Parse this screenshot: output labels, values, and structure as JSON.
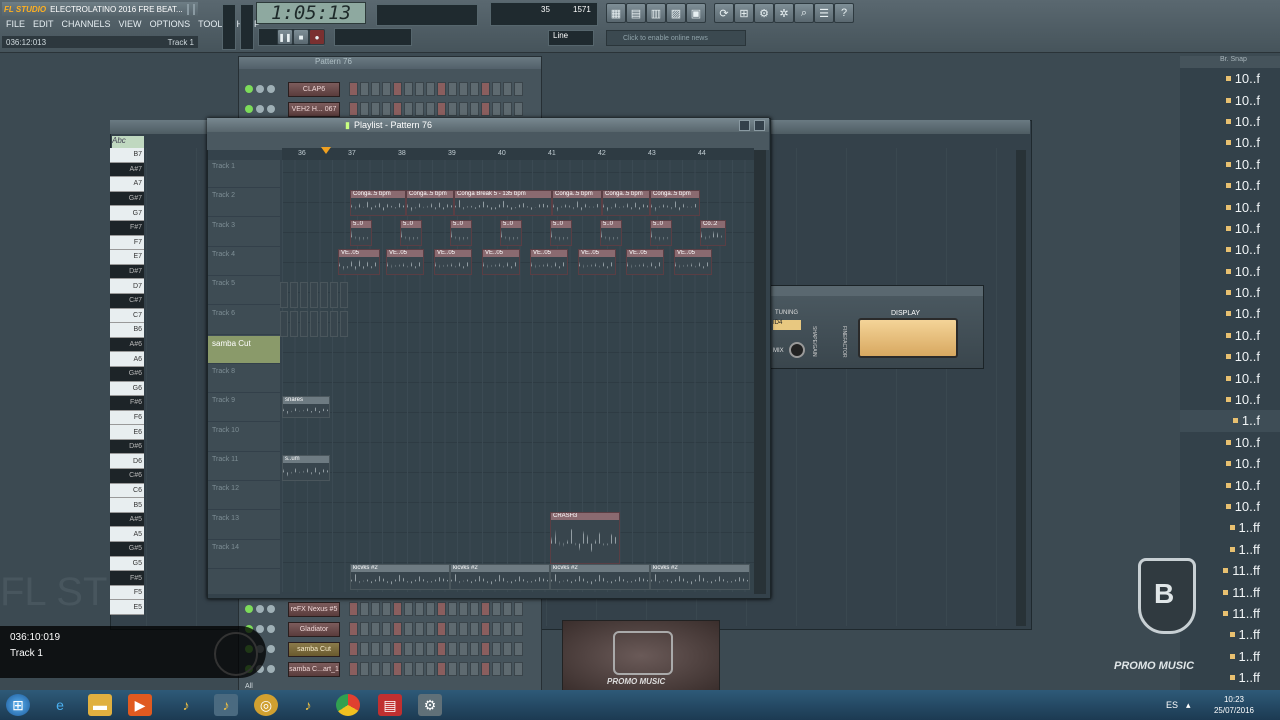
{
  "app": {
    "logo": "FL STUDIO",
    "title": "ELECTROLATINO 2016 FRE BEAT...",
    "menu": [
      "FILE",
      "EDIT",
      "CHANNELS",
      "VIEW",
      "OPTIONS",
      "TOOLS",
      "HELP"
    ],
    "hint_left": "036:12:013",
    "hint_right": "Track 1",
    "time": "1:05:13",
    "cpu_values": [
      "35",
      "1571"
    ],
    "mode": "Line",
    "news": "Click to enable online news"
  },
  "browser": {
    "header": "Br. Snap",
    "items": [
      "10..f",
      "10..f",
      "10..f",
      "10..f",
      "10..f",
      "10..f",
      "10..f",
      "10..f",
      "10..f",
      "10..f",
      "10..f",
      "10..f",
      "10..f",
      "10..f",
      "10..f",
      "10..f",
      "1..f",
      "10..f",
      "10..f",
      "10..f",
      "10..f",
      "1..ff",
      "1..ff",
      "11..ff",
      "11..ff",
      "11..ff",
      "1..ff",
      "1..ff",
      "1..ff",
      "1..ff"
    ]
  },
  "piano_keys": [
    {
      "n": "B7",
      "t": "white"
    },
    {
      "n": "A#7",
      "t": "black"
    },
    {
      "n": "A7",
      "t": "white"
    },
    {
      "n": "G#7",
      "t": "black"
    },
    {
      "n": "G7",
      "t": "white"
    },
    {
      "n": "F#7",
      "t": "black"
    },
    {
      "n": "F7",
      "t": "white"
    },
    {
      "n": "E7",
      "t": "white"
    },
    {
      "n": "D#7",
      "t": "black"
    },
    {
      "n": "D7",
      "t": "white"
    },
    {
      "n": "C#7",
      "t": "black"
    },
    {
      "n": "C7",
      "t": "white"
    },
    {
      "n": "B6",
      "t": "white"
    },
    {
      "n": "A#6",
      "t": "black"
    },
    {
      "n": "A6",
      "t": "white"
    },
    {
      "n": "G#6",
      "t": "black"
    },
    {
      "n": "G6",
      "t": "white"
    },
    {
      "n": "F#6",
      "t": "black"
    },
    {
      "n": "F6",
      "t": "white"
    },
    {
      "n": "E6",
      "t": "white"
    },
    {
      "n": "D#6",
      "t": "black"
    },
    {
      "n": "D6",
      "t": "white"
    },
    {
      "n": "C#6",
      "t": "black"
    },
    {
      "n": "C6",
      "t": "white"
    },
    {
      "n": "B5",
      "t": "white"
    },
    {
      "n": "A#5",
      "t": "black"
    },
    {
      "n": "A5",
      "t": "white"
    },
    {
      "n": "G#5",
      "t": "black"
    },
    {
      "n": "G5",
      "t": "white"
    },
    {
      "n": "F#5",
      "t": "black"
    },
    {
      "n": "F5",
      "t": "white"
    },
    {
      "n": "E5",
      "t": "white"
    }
  ],
  "seq_top": {
    "title": "Pattern 76",
    "channels": [
      {
        "name": "CLAP6",
        "y": false
      },
      {
        "name": "VEH2 H... 067",
        "y": false
      }
    ]
  },
  "seq_bottom": {
    "channels": [
      {
        "name": "reFX Nexus #5",
        "y": false
      },
      {
        "name": "Gladiator",
        "y": false
      },
      {
        "name": "samba Cut",
        "y": true
      },
      {
        "name": "samba C...art_1",
        "y": false
      }
    ],
    "footer": "All"
  },
  "playlist": {
    "title": "Playlist - Pattern 76",
    "ruler": [
      "36",
      "37",
      "38",
      "39",
      "40",
      "41",
      "42",
      "43",
      "44"
    ],
    "tracks": [
      "Track 1",
      "Track 2",
      "Track 3",
      "Track 4",
      "Track 5",
      "Track 6",
      "samba Cut",
      "Track 8",
      "Track 9",
      "Track 10",
      "Track 11",
      "Track 12",
      "Track 13",
      "Track 14"
    ],
    "clips": {
      "conga": [
        "Conga..5 bpm",
        "Conga..5 bpm",
        "Conga Break 5 - 135 bpm",
        "Conga..5 bpm",
        "Conga..5 bpm",
        "Conga..5 bpm"
      ],
      "t3": [
        "5..0",
        "5..0",
        "5..0",
        "5..0",
        "5..0",
        "5..0",
        "5..0",
        "Co..2"
      ],
      "ve": [
        "VE..05",
        "VE..05",
        "VE..05",
        "VE..05",
        "VE..05",
        "VE..05",
        "VE..05",
        "VE..05"
      ],
      "snares": "snares",
      "um": "s..um",
      "crash": "CRASH3",
      "kicks": [
        "kicvks #2",
        "kicvks #2",
        "kicvks #2",
        "kicvks #2"
      ]
    }
  },
  "plugin": {
    "display_label": "DISPLAY",
    "tuning_label": "TUNING",
    "mix_label": "MIX",
    "vert1": "SHAPE/GAIN",
    "vert2": "FINEFACTOR",
    "small_readout": "ID4"
  },
  "overlay": {
    "time": "036:10:019",
    "track": "Track 1"
  },
  "watermark": "FL ST",
  "promo": {
    "brand": "PROMO MUSIC"
  },
  "taskbar": {
    "lang": "ES",
    "time": "10:23",
    "date": "25/07/2016"
  }
}
